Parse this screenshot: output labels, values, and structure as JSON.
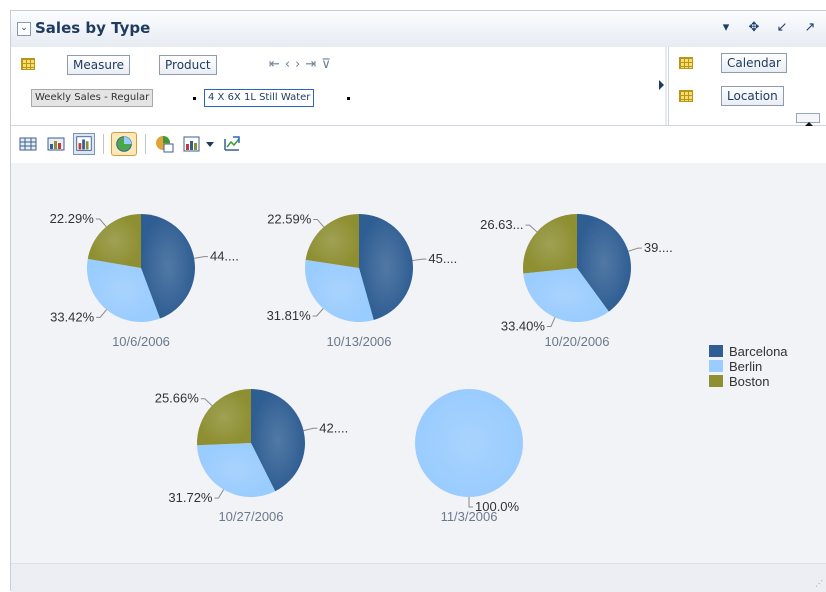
{
  "window": {
    "title": "Sales by Type"
  },
  "titlebar_icons": [
    "dropdown-icon",
    "move-icon",
    "restore-icon",
    "maximize-icon"
  ],
  "edge": {
    "left_items": [
      "Measure",
      "Product"
    ],
    "filter_measure": "Weekly Sales - Regular",
    "filter_product": "4 X 6X 1L Still Water",
    "right_items": [
      "Calendar",
      "Location"
    ]
  },
  "toolbar": {
    "tools": [
      "table-view-icon",
      "table-and-graph-icon",
      "graph-view-icon",
      "pie-chart-icon",
      "pivot-icon",
      "save-icon",
      "dropdown-icon",
      "export-icon"
    ],
    "selected": "pie-chart"
  },
  "colors": {
    "Barcelona": "#2f5e93",
    "Berlin": "#99ccff",
    "Boston": "#8e8f31"
  },
  "chart_data": {
    "type": "pie",
    "legend_position": "right",
    "series_names": [
      "Barcelona",
      "Berlin",
      "Boston"
    ],
    "pies": [
      {
        "label": "10/6/2006",
        "values": [
          44.29,
          33.42,
          22.29
        ],
        "labels": [
          "44....",
          "33.42%",
          "22.29%"
        ]
      },
      {
        "label": "10/13/2006",
        "values": [
          45.6,
          31.81,
          22.59
        ],
        "labels": [
          "45....",
          "31.81%",
          "22.59%"
        ]
      },
      {
        "label": "10/20/2006",
        "values": [
          39.97,
          33.4,
          26.63
        ],
        "labels": [
          "39....",
          "33.40%",
          "26.63..."
        ]
      },
      {
        "label": "10/27/2006",
        "values": [
          42.62,
          31.72,
          25.66
        ],
        "labels": [
          "42....",
          "31.72%",
          "25.66%"
        ]
      },
      {
        "label": "11/3/2006",
        "values": [
          0,
          100.0,
          0
        ],
        "labels": [
          "",
          "100.0%",
          ""
        ]
      }
    ]
  }
}
